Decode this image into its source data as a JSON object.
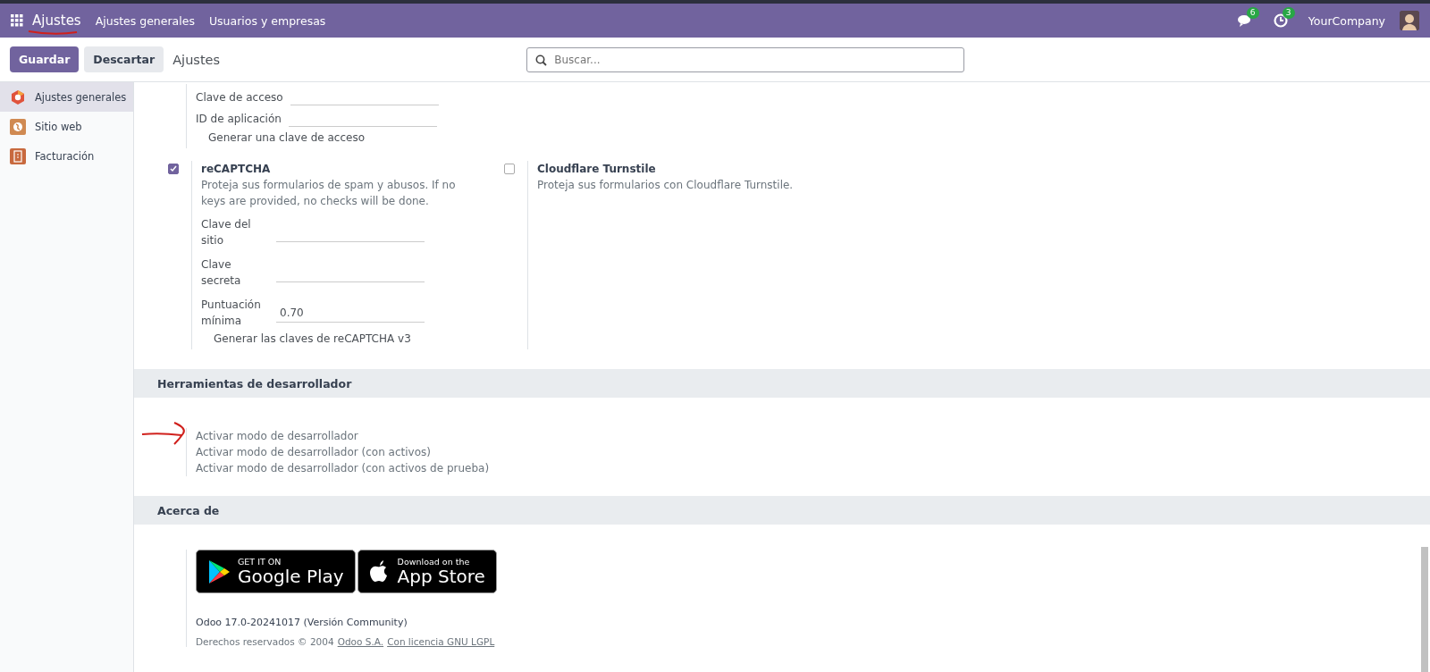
{
  "topbar": {
    "app": "Ajustes",
    "menu": [
      {
        "label": "Ajustes generales"
      },
      {
        "label": "Usuarios y empresas"
      }
    ],
    "messages_badge": "6",
    "activities_badge": "3",
    "company": "YourCompany"
  },
  "control_bar": {
    "buttons": [
      {
        "label": "Guardar",
        "kind": "primary"
      },
      {
        "label": "Descartar",
        "kind": "secondary"
      }
    ],
    "breadcrumb": "Ajustes",
    "search": {
      "placeholder": "Buscar..."
    }
  },
  "sidebar": {
    "items": [
      {
        "label": "Ajustes generales",
        "kind": "general",
        "selected": true
      },
      {
        "label": "Sitio web",
        "kind": "website",
        "selected": false
      },
      {
        "label": "Facturación",
        "kind": "invoicing",
        "selected": false
      }
    ]
  },
  "access_key": {
    "fields": [
      {
        "label": "Clave de acceso"
      },
      {
        "label": "ID de aplicación"
      }
    ],
    "link": "Generar una clave de acceso"
  },
  "options": [
    {
      "title": "reCAPTCHA",
      "checked": true,
      "description": "Proteja sus formularios de spam y abusos. If no keys are provided, no checks will be done.",
      "fields": [
        {
          "label": "Clave del sitio"
        },
        {
          "label": "Clave secreta"
        },
        {
          "label": "Puntuación mínima",
          "value": "0.70"
        }
      ],
      "link": "Generar las claves de reCAPTCHA v3"
    },
    {
      "title": "Cloudflare Turnstile",
      "checked": false,
      "description": "Proteja sus formularios con Cloudflare Turnstile."
    }
  ],
  "developer_tools": {
    "title": "Herramientas de desarrollador",
    "links": [
      "Activar modo de desarrollador",
      "Activar modo de desarrollador (con activos)",
      "Activar modo de desarrollador (con activos de prueba)"
    ]
  },
  "about": {
    "title": "Acerca de",
    "store_badges": [
      {
        "kind": "google",
        "small": "GET IT ON",
        "big": "Google Play"
      },
      {
        "kind": "apple",
        "small": "Download on the",
        "big": "App Store"
      }
    ],
    "version": "Odoo 17.0-20241017 (Versión Community)",
    "copyright": "Derechos reservados © 2004",
    "links": [
      "Odoo S.A.",
      "Con licencia GNU LGPL"
    ]
  }
}
